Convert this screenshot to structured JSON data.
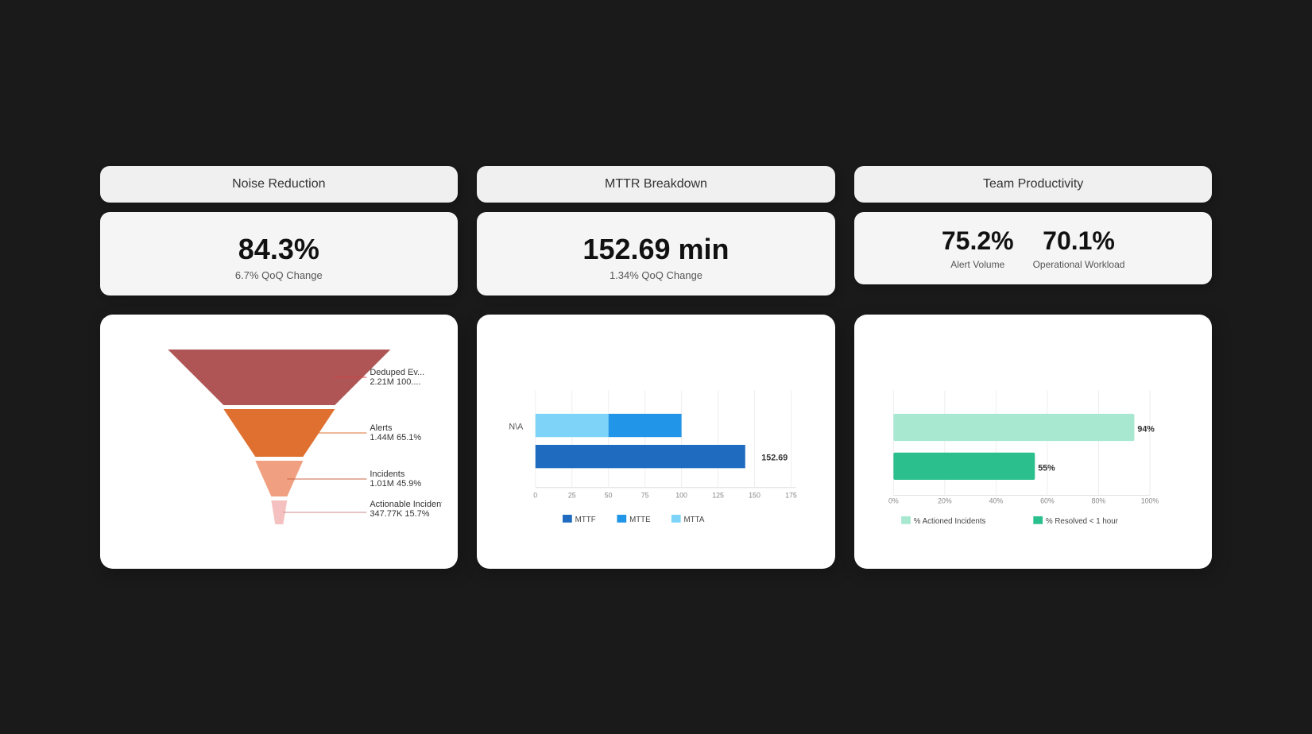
{
  "noise_reduction": {
    "title": "Noise Reduction",
    "value": "84.3%",
    "sub": "6.7% QoQ Change"
  },
  "mttr": {
    "title": "MTTR Breakdown",
    "value": "152.69 min",
    "sub": "1.34% QoQ Change"
  },
  "team_productivity": {
    "title": "Team Productivity",
    "alert_volume_value": "75.2%",
    "alert_volume_label": "Alert Volume",
    "operational_workload_value": "70.1%",
    "operational_workload_label": "Operational Workload"
  },
  "funnel": {
    "deduped_label": "Deduped Ev...",
    "deduped_value": "2.21M 100....",
    "alerts_label": "Alerts",
    "alerts_value": "1.44M 65.1%",
    "incidents_label": "Incidents",
    "incidents_value": "1.01M 45.9%",
    "actionable_label": "Actionable Incidents",
    "actionable_value": "347.77K 15.7%"
  },
  "bar_chart": {
    "y_label": "N\\A",
    "bar_value": "152.69",
    "x_ticks": [
      "0",
      "25",
      "50",
      "75",
      "100",
      "125",
      "150",
      "175"
    ],
    "legend": [
      {
        "label": "MTTF",
        "color": "#1e6bbf"
      },
      {
        "label": "MTTE",
        "color": "#2196e8"
      },
      {
        "label": "MTTA",
        "color": "#7dd4f8"
      }
    ]
  },
  "hbar_chart": {
    "bar1_value": "94%",
    "bar1_pct": 94,
    "bar2_value": "55%",
    "bar2_pct": 55,
    "x_ticks": [
      "0%",
      "20%",
      "40%",
      "60%",
      "80%",
      "100%"
    ],
    "legend": [
      {
        "label": "% Actioned Incidents",
        "color": "#a8e8d0"
      },
      {
        "label": "% Resolved < 1 hour",
        "color": "#2abf8c"
      }
    ]
  }
}
